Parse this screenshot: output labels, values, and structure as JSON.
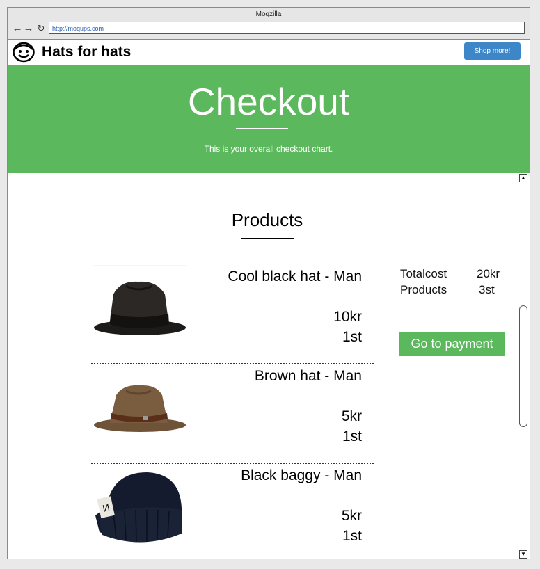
{
  "browser": {
    "title": "Moqzilla",
    "url": "http://moqups.com"
  },
  "site": {
    "brand": "Hats for hats",
    "shop_button": "Shop more!"
  },
  "hero": {
    "title": "Checkout",
    "subtitle": "This is your overall checkout chart."
  },
  "products_section": {
    "title": "Products",
    "items": [
      {
        "name": "Cool black hat - Man",
        "price": "10kr",
        "qty": "1st",
        "image": "black-fedora"
      },
      {
        "name": "Brown hat - Man",
        "price": "5kr",
        "qty": "1st",
        "image": "brown-hat"
      },
      {
        "name": "Black baggy - Man",
        "price": "5kr",
        "qty": "1st",
        "image": "black-beanie"
      }
    ]
  },
  "summary": {
    "total_label": "Totalcost",
    "total_value": "20kr",
    "products_label": "Products",
    "products_value": "3st",
    "pay_button": "Go to payment"
  },
  "colors": {
    "accent_green": "#5cb85c",
    "shop_blue": "#3d87c9"
  }
}
